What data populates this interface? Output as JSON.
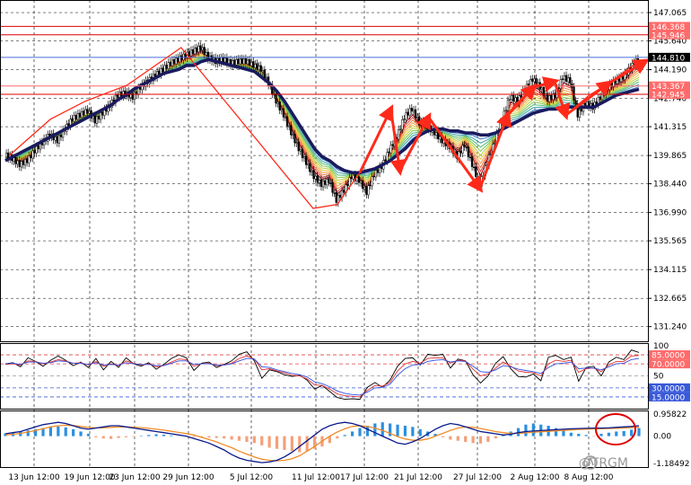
{
  "chart_data": {
    "type": "line",
    "title": "",
    "main": {
      "y_ticks": [
        "147.065",
        "145.640",
        "144.190",
        "142.740",
        "141.315",
        "139.865",
        "138.440",
        "136.990",
        "135.565",
        "134.115",
        "132.665",
        "131.240"
      ],
      "y_range": [
        130.5,
        147.7
      ],
      "x_ticks": [
        "13 Jun 12:00",
        "19 Jun 12:00",
        "23 Jun 12:00",
        "29 Jun 12:00",
        "5 Jul 12:00",
        "11 Jul 12:00",
        "17 Jul 12:00",
        "21 Jul 12:00",
        "27 Jul 12:00",
        "2 Aug 12:00",
        "8 Aug 12:00"
      ],
      "price": [
        139.9,
        139.7,
        139.4,
        139.6,
        140.1,
        140.5,
        140.9,
        140.6,
        141.2,
        141.7,
        141.9,
        142.1,
        141.6,
        142.0,
        142.4,
        142.9,
        143.0,
        142.8,
        143.3,
        143.6,
        143.9,
        144.2,
        144.5,
        144.7,
        144.9,
        145.1,
        145.3,
        144.8,
        144.6,
        144.7,
        144.5,
        144.6,
        144.6,
        144.4,
        144.2,
        143.5,
        142.6,
        141.9,
        141.0,
        140.2,
        139.5,
        138.8,
        138.4,
        138.6,
        137.6,
        138.1,
        138.8,
        138.6,
        138.0,
        138.9,
        139.3,
        140.1,
        140.8,
        141.8,
        142.2,
        141.5,
        141.3,
        141.0,
        140.6,
        140.3,
        139.8,
        140.4,
        139.4,
        138.4,
        139.5,
        140.6,
        141.7,
        142.8,
        142.6,
        143.2,
        143.7,
        143.3,
        142.7,
        142.9,
        143.8,
        143.6,
        141.9,
        142.5,
        142.3,
        142.8,
        143.3,
        143.6,
        143.8,
        144.3,
        144.7
      ],
      "slow_ma": [
        139.6,
        139.8,
        140.0,
        140.2,
        140.4,
        140.6,
        140.8,
        141.0,
        141.2,
        141.4,
        141.6,
        141.8,
        142.0,
        142.2,
        142.4,
        142.7,
        142.9,
        143.2,
        143.4,
        143.6,
        143.8,
        144.0,
        144.1,
        144.2,
        144.4,
        144.4,
        144.6,
        144.7,
        144.6,
        144.5,
        144.4,
        144.3,
        144.2,
        144.1,
        143.8,
        143.5,
        143.1,
        142.6,
        142.0,
        141.4,
        140.8,
        140.2,
        139.8,
        139.6,
        139.3,
        139.1,
        139.0,
        139.0,
        139.1,
        139.2,
        139.4,
        139.6,
        139.9,
        140.2,
        140.6,
        140.9,
        141.1,
        141.2,
        141.2,
        141.1,
        141.1,
        141.0,
        141.0,
        140.9,
        140.9,
        141.0,
        141.2,
        141.4,
        141.6,
        141.8,
        142.0,
        142.1,
        142.2,
        142.2,
        142.3,
        142.3,
        142.3,
        142.3,
        142.3,
        142.5,
        142.7,
        142.9,
        143.0,
        143.1,
        143.2
      ],
      "fan_colors": [
        "#c00000",
        "#e04040",
        "#f07a3a",
        "#f0a040",
        "#e8c840",
        "#b8d040",
        "#7cc850",
        "#50b878",
        "#40a0a8",
        "#3a78c8"
      ],
      "hlines": [
        {
          "value": "146.368",
          "color": "#e00000",
          "label_bg": "#ff6b6b"
        },
        {
          "value": "145.946",
          "color": "#e00000",
          "label_bg": "#ff6b6b"
        },
        {
          "value": "144.810",
          "color": "#4a6fd8",
          "label_bg": "#000000"
        },
        {
          "value": "143.367",
          "color": "#ff6b6b",
          "label_bg": "#ff6b6b"
        },
        {
          "value": "142.945",
          "color": "#e00000",
          "label_bg": "#ff6b6b"
        }
      ],
      "swing_points": [
        [
          0.48,
          139.85
        ],
        [
          6.0,
          141.7
        ],
        [
          10.6,
          142.6
        ],
        [
          16.1,
          143.4
        ],
        [
          23.3,
          145.3
        ],
        [
          40.8,
          137.2
        ],
        [
          44.0,
          137.4
        ],
        [
          47.0,
          139.0
        ],
        [
          51.1,
          142.2
        ],
        [
          52.3,
          139.1
        ],
        [
          56.1,
          141.8
        ],
        [
          62.9,
          138.2
        ],
        [
          66.6,
          141.9
        ],
        [
          67.5,
          142.4
        ],
        [
          70.0,
          143.3
        ],
        [
          72.8,
          143.6
        ],
        [
          74.3,
          141.9
        ],
        [
          77.4,
          142.9
        ],
        [
          80.0,
          143.5
        ],
        [
          83.2,
          144.4
        ],
        [
          84.8,
          144.6
        ]
      ]
    },
    "osc": {
      "y_ticks": [
        "100",
        "85.0000",
        "70.0000",
        "50",
        "30.0000",
        "15.0000"
      ],
      "y_range": [
        0,
        100
      ],
      "level_lines": [
        85,
        70,
        50,
        30,
        15
      ],
      "black": [
        70,
        72,
        65,
        80,
        74,
        66,
        76,
        83,
        76,
        67,
        73,
        64,
        79,
        60,
        74,
        64,
        80,
        70,
        66,
        72,
        61,
        69,
        79,
        85,
        80,
        59,
        71,
        73,
        64,
        69,
        75,
        86,
        90,
        75,
        46,
        60,
        57,
        52,
        49,
        51,
        43,
        28,
        34,
        24,
        14,
        11,
        12,
        11,
        31,
        39,
        31,
        43,
        66,
        79,
        80,
        68,
        86,
        84,
        86,
        63,
        78,
        75,
        52,
        38,
        50,
        71,
        82,
        62,
        49,
        48,
        53,
        42,
        81,
        84,
        77,
        81,
        41,
        64,
        66,
        50,
        73,
        81,
        77,
        93,
        89
      ],
      "red": [
        69,
        70,
        68,
        75,
        74,
        70,
        73,
        77,
        75,
        71,
        72,
        68,
        74,
        66,
        70,
        67,
        75,
        71,
        68,
        70,
        65,
        67,
        73,
        78,
        77,
        66,
        70,
        71,
        67,
        68,
        71,
        79,
        83,
        78,
        60,
        62,
        58,
        55,
        51,
        50,
        45,
        35,
        34,
        28,
        20,
        17,
        16,
        15,
        26,
        34,
        33,
        39,
        58,
        70,
        74,
        71,
        79,
        80,
        80,
        71,
        76,
        75,
        61,
        50,
        53,
        63,
        73,
        66,
        58,
        56,
        55,
        50,
        70,
        76,
        74,
        76,
        56,
        62,
        63,
        57,
        68,
        74,
        74,
        83,
        84
      ],
      "blue": [
        70,
        71,
        69,
        73,
        73,
        71,
        72,
        75,
        74,
        71,
        71,
        69,
        72,
        68,
        69,
        68,
        72,
        70,
        69,
        69,
        67,
        67,
        71,
        75,
        75,
        69,
        70,
        70,
        68,
        68,
        70,
        75,
        79,
        78,
        65,
        64,
        60,
        57,
        54,
        52,
        48,
        40,
        37,
        32,
        25,
        21,
        19,
        18,
        23,
        30,
        31,
        36,
        51,
        62,
        68,
        69,
        74,
        76,
        77,
        73,
        75,
        74,
        66,
        57,
        56,
        60,
        67,
        65,
        61,
        59,
        57,
        54,
        64,
        70,
        71,
        73,
        62,
        63,
        63,
        60,
        65,
        70,
        71,
        77,
        79
      ]
    },
    "macd": {
      "y_ticks": [
        "0.95822",
        "0.00",
        "-1.18492"
      ],
      "y_range": [
        -1.18492,
        0.95822
      ],
      "hist": [
        0.12,
        0.15,
        0.2,
        0.25,
        0.3,
        0.35,
        0.4,
        0.42,
        0.38,
        0.3,
        0.2,
        0.1,
        -0.05,
        -0.1,
        -0.12,
        -0.08,
        -0.05,
        -0.03,
        0.02,
        0.05,
        0.08,
        0.06,
        0.03,
        0.0,
        -0.02,
        -0.04,
        -0.05,
        -0.06,
        -0.08,
        -0.1,
        -0.15,
        -0.2,
        -0.25,
        -0.3,
        -0.4,
        -0.5,
        -0.55,
        -0.6,
        -0.65,
        -0.7,
        -0.65,
        -0.55,
        -0.45,
        -0.3,
        -0.1,
        0.05,
        0.2,
        0.35,
        0.45,
        0.55,
        0.6,
        0.55,
        0.5,
        0.45,
        0.4,
        0.3,
        0.2,
        0.1,
        -0.05,
        -0.15,
        -0.2,
        -0.25,
        -0.3,
        -0.32,
        -0.25,
        -0.1,
        0.05,
        0.2,
        0.35,
        0.5,
        0.55,
        0.5,
        0.45,
        0.35,
        0.25,
        0.15,
        0.1,
        0.05,
        -0.02,
        0.1,
        0.15,
        0.2,
        0.22,
        0.28,
        0.35
      ],
      "line_main": [
        0.1,
        0.15,
        0.2,
        0.3,
        0.4,
        0.5,
        0.55,
        0.6,
        0.55,
        0.45,
        0.35,
        0.3,
        0.35,
        0.4,
        0.45,
        0.45,
        0.4,
        0.35,
        0.3,
        0.25,
        0.2,
        0.15,
        0.1,
        0.05,
        0.0,
        -0.1,
        -0.2,
        -0.3,
        -0.45,
        -0.6,
        -0.8,
        -0.95,
        -1.05,
        -1.1,
        -1.15,
        -1.12,
        -1.05,
        -0.9,
        -0.7,
        -0.45,
        -0.2,
        0.05,
        0.3,
        0.45,
        0.55,
        0.6,
        0.55,
        0.45,
        0.3,
        0.15,
        0.0,
        -0.15,
        -0.3,
        -0.35,
        -0.25,
        -0.1,
        0.1,
        0.3,
        0.45,
        0.55,
        0.5,
        0.4,
        0.3,
        0.2,
        0.15,
        0.1,
        0.05,
        0.08,
        0.15,
        0.2,
        0.22,
        0.24,
        0.26,
        0.28,
        0.3,
        0.32,
        0.33,
        0.34,
        0.35,
        0.35,
        0.36,
        0.38,
        0.4,
        0.42,
        0.45
      ],
      "line_signal": [
        0.05,
        0.08,
        0.12,
        0.18,
        0.25,
        0.32,
        0.4,
        0.45,
        0.47,
        0.46,
        0.42,
        0.38,
        0.36,
        0.36,
        0.38,
        0.4,
        0.4,
        0.39,
        0.37,
        0.34,
        0.3,
        0.26,
        0.21,
        0.16,
        0.11,
        0.05,
        -0.05,
        -0.15,
        -0.25,
        -0.38,
        -0.5,
        -0.65,
        -0.78,
        -0.9,
        -1.0,
        -1.05,
        -1.07,
        -1.05,
        -0.98,
        -0.85,
        -0.65,
        -0.45,
        -0.22,
        0.0,
        0.18,
        0.32,
        0.42,
        0.45,
        0.42,
        0.35,
        0.25,
        0.12,
        -0.02,
        -0.12,
        -0.18,
        -0.18,
        -0.12,
        0.0,
        0.12,
        0.25,
        0.35,
        0.4,
        0.38,
        0.33,
        0.27,
        0.2,
        0.15,
        0.12,
        0.12,
        0.14,
        0.17,
        0.19,
        0.21,
        0.23,
        0.25,
        0.27,
        0.29,
        0.3,
        0.31,
        0.32,
        0.33,
        0.34,
        0.35,
        0.37,
        0.39
      ],
      "colors": {
        "pos": "#2a8fe0",
        "neg": "#f4a07a",
        "main": "#0a1a8c",
        "signal": "#f08c28"
      }
    }
  },
  "watermark": "@TRGM",
  "colors": {
    "slow_ma": "#1a1a5e",
    "arrows": "#ff2a1a",
    "swing": "#ff2a1a",
    "circle": "#e00000"
  }
}
